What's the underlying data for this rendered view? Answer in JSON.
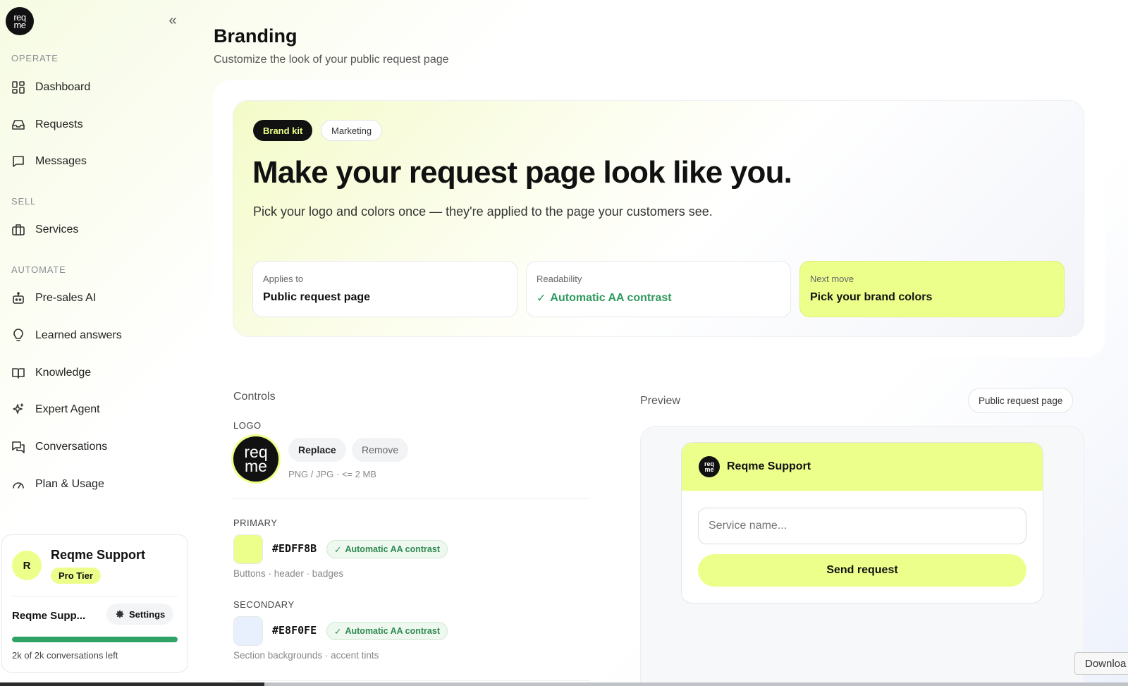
{
  "sidebar": {
    "logo_text_top": "req",
    "logo_text_bottom": "me",
    "sections": {
      "operate": "OPERATE",
      "sell": "SELL",
      "automate": "AUTOMATE"
    },
    "items": {
      "dashboard": "Dashboard",
      "requests": "Requests",
      "messages": "Messages",
      "services": "Services",
      "presales": "Pre-sales AI",
      "learned": "Learned answers",
      "knowledge": "Knowledge",
      "expert": "Expert Agent",
      "conversations": "Conversations",
      "plan": "Plan & Usage"
    },
    "account": {
      "avatar_initial": "R",
      "name": "Reqme Support",
      "tier": "Pro Tier",
      "short_name": "Reqme Supp...",
      "settings_label": "Settings",
      "usage_fraction": 1.0,
      "usage_text": "2k of 2k conversations left"
    }
  },
  "header": {
    "title": "Branding",
    "subtitle": "Customize the look of your public request page"
  },
  "hero": {
    "badge_primary": "Brand kit",
    "badge_secondary": "Marketing",
    "title": "Make your request page look like you.",
    "description": "Pick your logo and colors once — they're applied to the page your customers see.",
    "stats": [
      {
        "label": "Applies to",
        "value": "Public request page"
      },
      {
        "label": "Readability",
        "value": "Automatic AA contrast"
      },
      {
        "label": "Next move",
        "value": "Pick your brand colors"
      }
    ]
  },
  "controls": {
    "title": "Controls",
    "logo_label": "LOGO",
    "replace_label": "Replace",
    "remove_label": "Remove",
    "logo_hint": "PNG / JPG · <= 2 MB",
    "primary": {
      "label": "PRIMARY",
      "hex": "#EDFF8B",
      "badge": "Automatic AA contrast",
      "note": "Buttons · header · badges"
    },
    "secondary": {
      "label": "SECONDARY",
      "hex": "#E8F0FE",
      "badge": "Automatic AA contrast",
      "note": "Section backgrounds · accent tints"
    }
  },
  "preview": {
    "title": "Preview",
    "tag": "Public request page",
    "brand_name": "Reqme Support",
    "input_placeholder": "Service name...",
    "send_label": "Send request"
  },
  "overlay": {
    "download_tooltip": "Downloa"
  },
  "colors": {
    "accent": "#EDFF8B",
    "secondary": "#E8F0FE",
    "success": "#2F9A5F",
    "dark": "#111111"
  }
}
